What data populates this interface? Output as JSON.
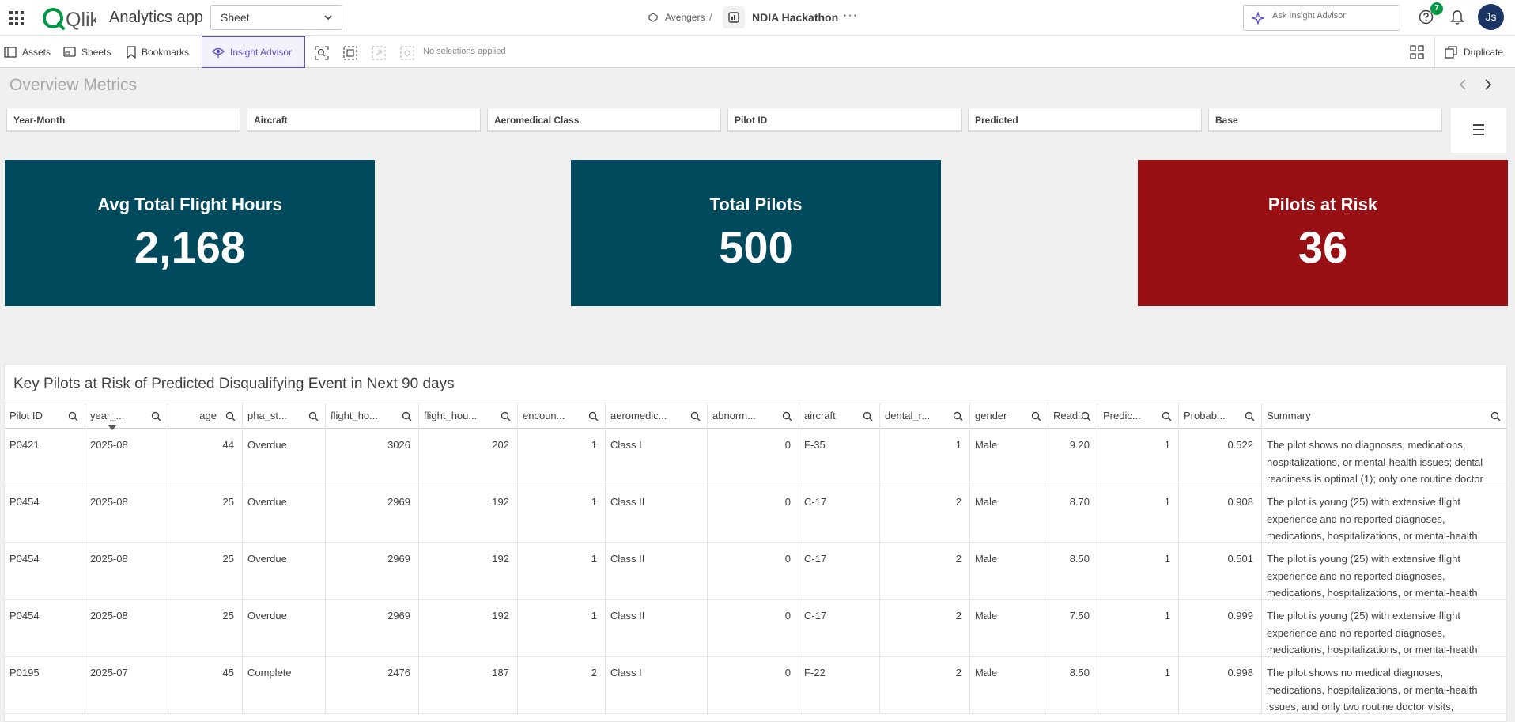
{
  "app": {
    "logo_text": "Qlik",
    "title": "Analytics app",
    "sheet_select": "Sheet",
    "space": "Avengers",
    "separator": "/",
    "app_name": "NDIA Hackathon",
    "more": "···",
    "ask_placeholder": "Ask Insight Advisor",
    "help_badge": "7",
    "avatar_initials": "Js"
  },
  "toolbar": {
    "assets": "Assets",
    "sheets": "Sheets",
    "bookmarks": "Bookmarks",
    "insight_advisor": "Insight Advisor",
    "no_selections": "No selections applied",
    "duplicate": "Duplicate"
  },
  "sheet": {
    "title": "Overview Metrics",
    "filters": [
      "Year-Month",
      "Aircraft",
      "Aeromedical Class",
      "Pilot ID",
      "Predicted",
      "Base"
    ]
  },
  "kpis": [
    {
      "label": "Avg Total Flight Hours",
      "value": "2,168",
      "color": "#004a5e"
    },
    {
      "label": "Total Pilots",
      "value": "500",
      "color": "#004a5e"
    },
    {
      "label": "Pilots at Risk",
      "value": "36",
      "color": "#980f14"
    }
  ],
  "table": {
    "title": "Key Pilots at Risk of Predicted Disqualifying Event in Next 90 days",
    "columns": [
      "Pilot ID",
      "year_...",
      "age",
      "pha_st...",
      "flight_ho...",
      "flight_hou...",
      "encoun...",
      "aeromedic...",
      "abnorm...",
      "aircraft",
      "dental_r...",
      "gender",
      "Readi...",
      "Predic...",
      "Probab...",
      "Summary"
    ],
    "rows": [
      [
        "P0421",
        "2025-08",
        "44",
        "Overdue",
        "3026",
        "202",
        "1",
        "Class I",
        "0",
        "F-35",
        "1",
        "Male",
        "9.20",
        "1",
        "0.522",
        "The pilot shows no diagnoses, medications, hospitalizations, or mental-health issues; dental readiness is optimal (1); only one routine doctor"
      ],
      [
        "P0454",
        "2025-08",
        "25",
        "Overdue",
        "2969",
        "192",
        "1",
        "Class II",
        "0",
        "C-17",
        "2",
        "Male",
        "8.70",
        "1",
        "0.908",
        "The pilot is young (25) with extensive flight experience and no reported diagnoses, medications, hospitalizations, or mental-health"
      ],
      [
        "P0454",
        "2025-08",
        "25",
        "Overdue",
        "2969",
        "192",
        "1",
        "Class II",
        "0",
        "C-17",
        "2",
        "Male",
        "8.50",
        "1",
        "0.501",
        "The pilot is young (25) with extensive flight experience and no reported diagnoses, medications, hospitalizations, or mental-health"
      ],
      [
        "P0454",
        "2025-08",
        "25",
        "Overdue",
        "2969",
        "192",
        "1",
        "Class II",
        "0",
        "C-17",
        "2",
        "Male",
        "7.50",
        "1",
        "0.999",
        "The pilot is young (25) with extensive flight experience and no reported diagnoses, medications, hospitalizations, or mental-health"
      ],
      [
        "P0195",
        "2025-07",
        "45",
        "Complete",
        "2476",
        "187",
        "2",
        "Class I",
        "0",
        "F-22",
        "2",
        "Male",
        "8.50",
        "1",
        "0.998",
        "The pilot shows no medical diagnoses, medications, hospitalizations, or mental-health issues, and only two routine doctor visits,"
      ]
    ]
  }
}
